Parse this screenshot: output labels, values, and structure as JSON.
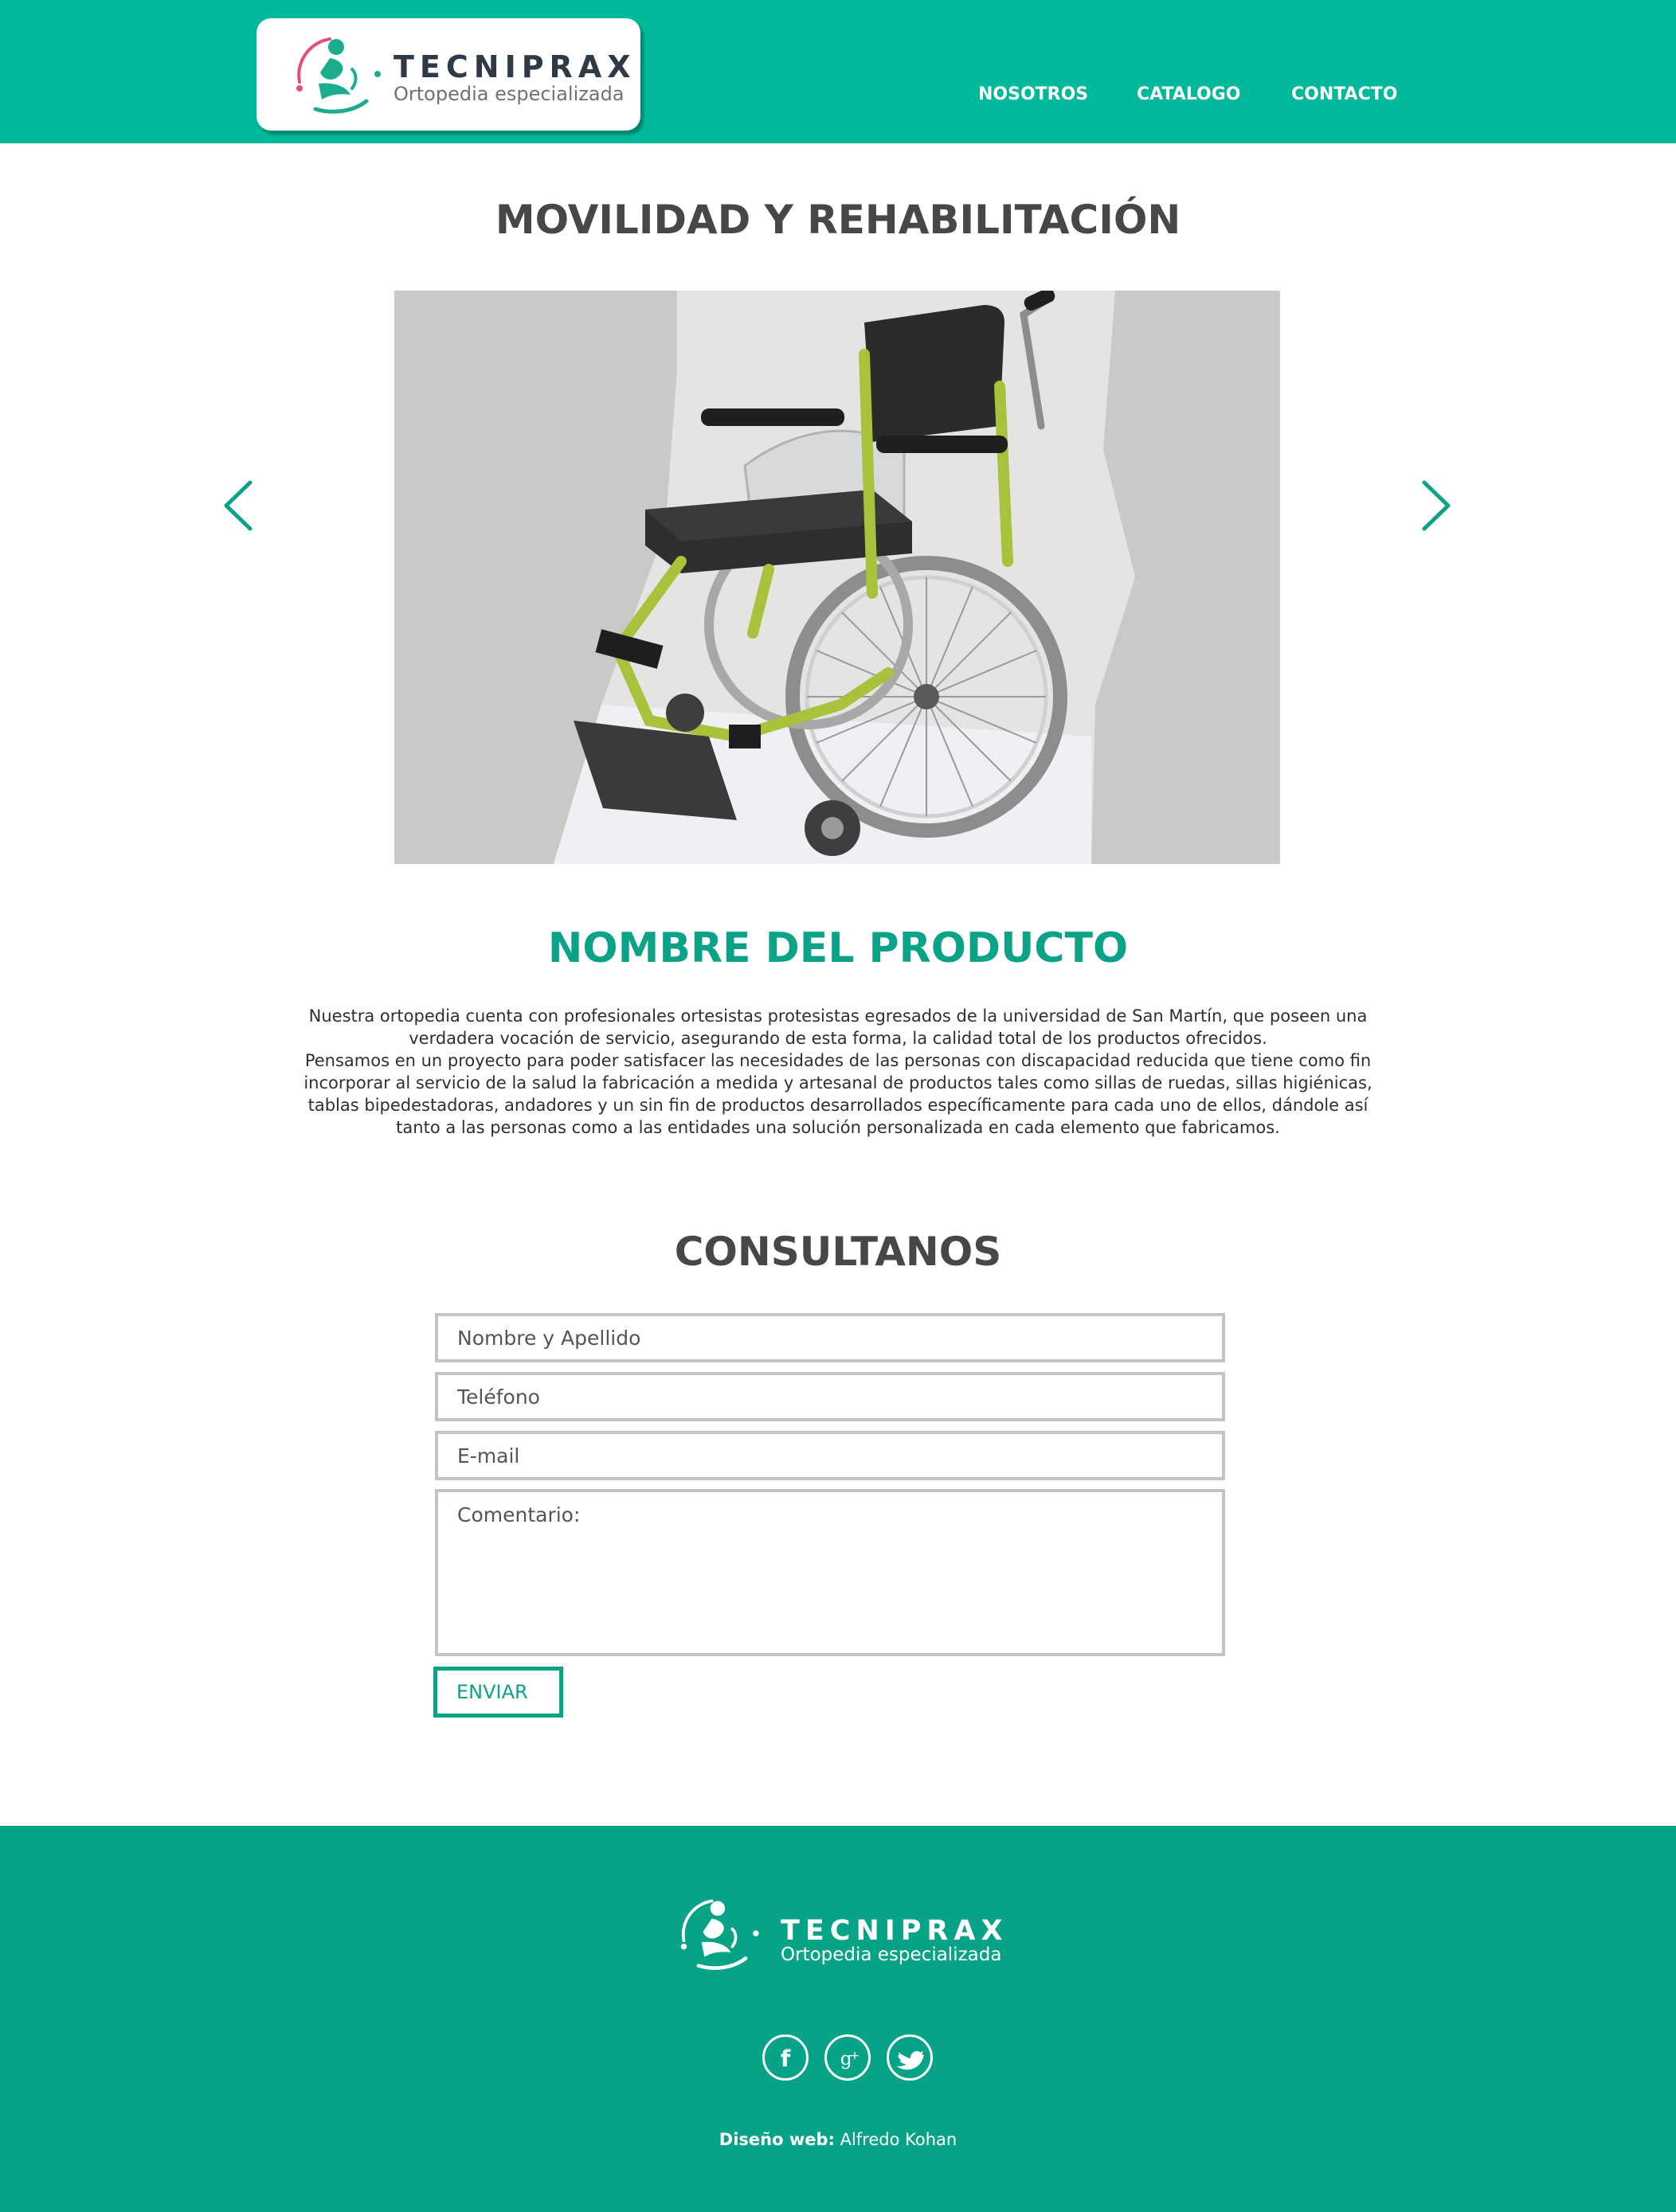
{
  "header": {
    "brand": "TECNIPRAX",
    "tagline": "Ortopedia especializada",
    "nav": [
      "NOSOTROS",
      "CATALOGO",
      "CONTACTO"
    ],
    "colors": {
      "bar": "#00b89a",
      "accent": "#0aa387"
    }
  },
  "hero": {
    "title": "MOVILIDAD Y REHABILITACIÓN",
    "image": "wheelchair-photo",
    "prev_icon": "chevron-left-icon",
    "next_icon": "chevron-right-icon"
  },
  "product": {
    "title": "NOMBRE DEL PRODUCTO",
    "description": [
      "Nuestra  ortopedia cuenta con profesionales ortesistas protesistas egresados de la  universidad de  San Martín, que poseen una",
      "verdadera vocación de servicio, asegurando de esta forma, la calidad total de los productos ofrecidos.",
      "Pensamos en un proyecto para poder satisfacer las necesidades de las personas con discapacidad reducida que tiene como fin",
      "incorporar al servicio de la salud la fabricación a medida y  artesanal de productos tales como sillas de ruedas, sillas higiénicas,",
      "tablas bipedestadoras, andadores y un sin fin de productos  desarrollados específicamente para cada uno de ellos, dándole así",
      "tanto a las personas como a las entidades una solución personalizada en cada elemento que fabricamos."
    ]
  },
  "form": {
    "title": "CONSULTANOS",
    "fields": {
      "name_placeholder": "Nombre y Apellido",
      "phone_placeholder": "Teléfono",
      "email_placeholder": "E-mail",
      "comment_placeholder": "Comentario:"
    },
    "submit_label": "ENVIAR"
  },
  "footer": {
    "brand": "TECNIPRAX",
    "tagline": "Ortopedia especializada",
    "social_icons": [
      "facebook-icon",
      "google-plus-icon",
      "twitter-icon"
    ],
    "credit_label": "Diseño web:",
    "credit_name": " Alfredo Kohan",
    "background": "#07a387"
  }
}
